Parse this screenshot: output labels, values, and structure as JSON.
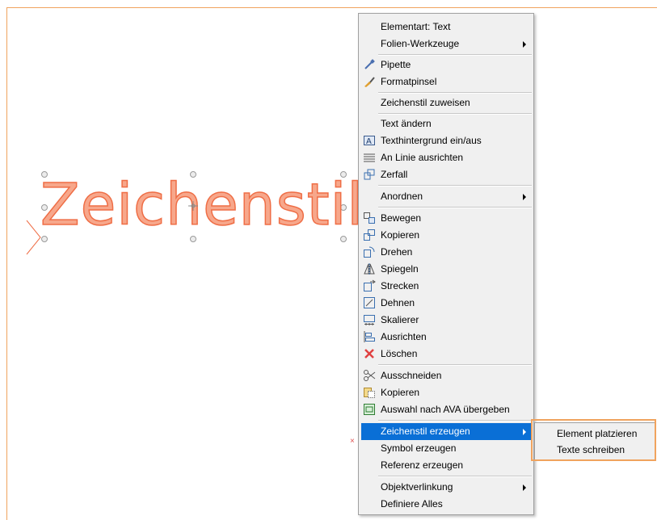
{
  "canvas": {
    "big_text": "Zeichenstil"
  },
  "menu": {
    "items": [
      {
        "label": "Elementart: Text",
        "icon": "",
        "submenu": false
      },
      {
        "label": "Folien-Werkzeuge",
        "icon": "",
        "submenu": true
      },
      {
        "label": "Pipette",
        "icon": "eyedropper-icon",
        "submenu": false
      },
      {
        "label": "Formatpinsel",
        "icon": "format-brush-icon",
        "submenu": false
      },
      {
        "label": "Zeichenstil zuweisen",
        "icon": "",
        "submenu": false
      },
      {
        "label": "Text ändern",
        "icon": "",
        "submenu": false
      },
      {
        "label": "Texthintergrund ein/aus",
        "icon": "text-background-icon",
        "submenu": false
      },
      {
        "label": "An Linie ausrichten",
        "icon": "align-to-line-icon",
        "submenu": false
      },
      {
        "label": "Zerfall",
        "icon": "explode-icon",
        "submenu": false
      },
      {
        "label": "Anordnen",
        "icon": "",
        "submenu": true
      },
      {
        "label": "Bewegen",
        "icon": "move-icon",
        "submenu": false
      },
      {
        "label": "Kopieren",
        "icon": "copy-elements-icon",
        "submenu": false
      },
      {
        "label": "Drehen",
        "icon": "rotate-icon",
        "submenu": false
      },
      {
        "label": "Spiegeln",
        "icon": "mirror-icon",
        "submenu": false
      },
      {
        "label": "Strecken",
        "icon": "stretch-icon",
        "submenu": false
      },
      {
        "label": "Dehnen",
        "icon": "extend-icon",
        "submenu": false
      },
      {
        "label": "Skalierer",
        "icon": "scale-icon",
        "submenu": false
      },
      {
        "label": "Ausrichten",
        "icon": "align-icon",
        "submenu": false
      },
      {
        "label": "Löschen",
        "icon": "delete-icon",
        "submenu": false
      },
      {
        "label": "Ausschneiden",
        "icon": "scissors-icon",
        "submenu": false
      },
      {
        "label": "Kopieren",
        "icon": "clipboard-copy-icon",
        "submenu": false
      },
      {
        "label": "Auswahl nach AVA übergeben",
        "icon": "ava-transfer-icon",
        "submenu": false
      },
      {
        "label": "Zeichenstil erzeugen",
        "icon": "",
        "submenu": true,
        "highlighted": true
      },
      {
        "label": "Symbol erzeugen",
        "icon": "",
        "submenu": false
      },
      {
        "label": "Referenz erzeugen",
        "icon": "",
        "submenu": false
      },
      {
        "label": "Objektverlinkung",
        "icon": "",
        "submenu": true
      },
      {
        "label": "Definiere Alles",
        "icon": "",
        "submenu": false
      }
    ]
  },
  "submenu": {
    "items": [
      {
        "label": "Element platzieren"
      },
      {
        "label": "Texte schreiben"
      }
    ]
  },
  "colors": {
    "accent_orange": "#f0a35e",
    "highlight_blue": "#0a6fd6",
    "text_fill": "#f7a78b",
    "text_stroke": "#ef6e46"
  }
}
